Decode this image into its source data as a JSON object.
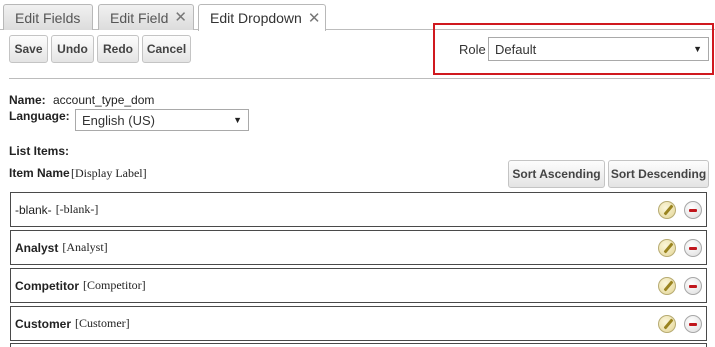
{
  "tabs": [
    {
      "label": "Edit Fields",
      "closable": false
    },
    {
      "label": "Edit Field",
      "closable": true
    },
    {
      "label": "Edit Dropdown",
      "closable": true,
      "active": true
    }
  ],
  "close_glyph": "✕",
  "toolbar": {
    "save": "Save",
    "undo": "Undo",
    "redo": "Redo",
    "cancel": "Cancel"
  },
  "role": {
    "label": "Role",
    "selected": "Default"
  },
  "name": {
    "label": "Name:",
    "value": "account_type_dom"
  },
  "language": {
    "label": "Language:",
    "selected": "English (US)"
  },
  "list_items_label": "List Items:",
  "item_header": {
    "name": "Item Name",
    "display": "[Display Label]"
  },
  "sort": {
    "ascending": "Sort Ascending",
    "descending": "Sort Descending"
  },
  "items": [
    {
      "name": "-blank-",
      "display": "[-blank-]"
    },
    {
      "name": "Analyst",
      "display": "[Analyst]"
    },
    {
      "name": "Competitor",
      "display": "[Competitor]"
    },
    {
      "name": "Customer",
      "display": "[Customer]"
    }
  ],
  "icons": {
    "edit": "pencil-icon",
    "delete": "minus-circle-icon",
    "dropdown": "chevron-down-icon"
  },
  "colors": {
    "highlight": "#d0191f",
    "delete": "#c0161c"
  }
}
